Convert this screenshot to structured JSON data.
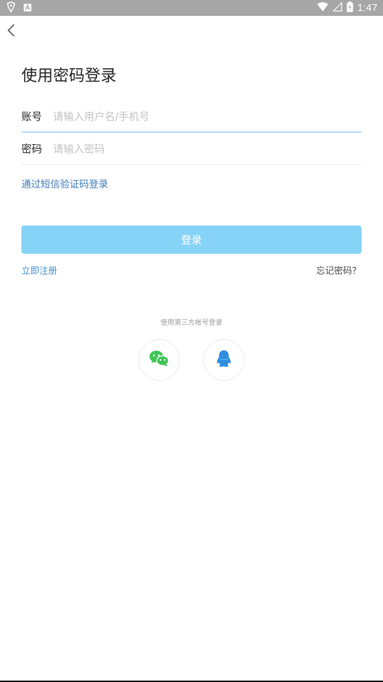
{
  "status_bar": {
    "time": "1:47"
  },
  "page": {
    "title": "使用密码登录"
  },
  "form": {
    "account_label": "账号",
    "account_placeholder": "请输入用户名/手机号",
    "password_label": "密码",
    "password_placeholder": "请输入密码",
    "sms_login_link": "通过短信验证码登录",
    "login_button": "登录",
    "register_link": "立即注册",
    "forgot_link": "忘记密码？"
  },
  "third_party": {
    "label": "使用第三方帐号登录",
    "providers": [
      {
        "icon": "wechat-icon",
        "color": "#3ec654"
      },
      {
        "icon": "qq-icon",
        "color": "#2e8ee0"
      }
    ]
  },
  "colors": {
    "accent": "#87d3f8",
    "link": "#3f7ab8",
    "status_bar": "#a6a6a6"
  }
}
